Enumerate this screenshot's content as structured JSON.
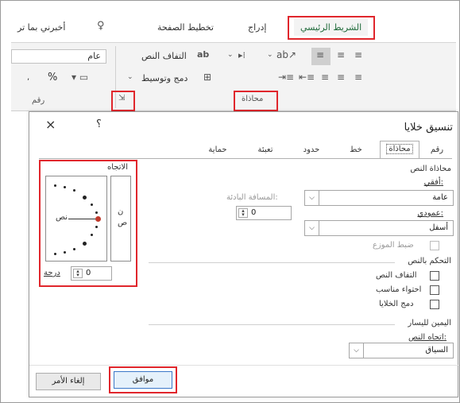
{
  "ribbon": {
    "tabs": {
      "tell_me": "أخبرني بما تر",
      "page_layout": "تخطيط الصفحة",
      "insert": "إدراج",
      "home": "الشريط الرئيسي"
    },
    "number_format": "عام",
    "percent": "%",
    "wrap_text": "التفاف النص",
    "merge_center": "دمج وتوسيط",
    "alignment_group": "محاذاة",
    "number_group": "رقم"
  },
  "dialog": {
    "title": "تنسيق خلايا",
    "help": "؟",
    "close": "×",
    "tabs": [
      "رقم",
      "محاذاة",
      "خط",
      "حدود",
      "تعبئة",
      "حماية"
    ],
    "text_alignment": {
      "section": "محاذاة النص",
      "horizontal_label": "أفقي:",
      "horizontal_value": "عامة",
      "indent_label": "المسافة البادئة:",
      "indent_value": "0",
      "vertical_label": "عمودي:",
      "vertical_value": "أسفل",
      "justify_distributed": "ضبط الموزع"
    },
    "text_control": {
      "section": "التحكم بالنص",
      "wrap_text": "التفاف النص",
      "shrink_to_fit": "احتواء مناسب",
      "merge_cells": "دمج الخلايا"
    },
    "rtl": {
      "section": "اليمين لليسار",
      "direction_label": "اتجاه النص:",
      "direction_value": "السياق"
    },
    "orientation": {
      "section": "الاتجاه",
      "vertical_text": "ن\nص",
      "text_word": "نص",
      "degrees_value": "0",
      "degrees_label": "درجة"
    },
    "ok": "موافق",
    "cancel": "إلغاء الأمر"
  }
}
